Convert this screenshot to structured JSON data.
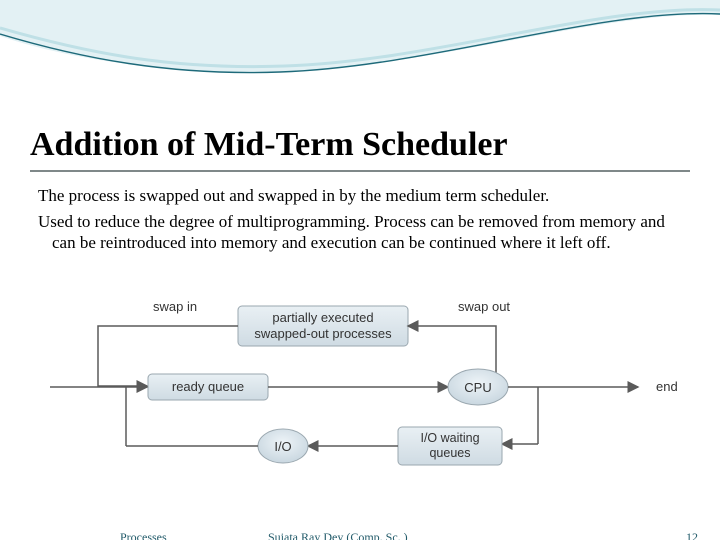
{
  "title": "Addition of Mid-Term Scheduler",
  "paragraphs": [
    "The process is swapped out and swapped in by the medium term scheduler.",
    "Used to reduce the degree of multiprogramming. Process can be removed from memory and can be reintroduced into memory and execution can be continued where it left off."
  ],
  "diagram": {
    "labels": {
      "swap_in": "swap in",
      "swap_out": "swap out"
    },
    "swapped_box": {
      "line1": "partially executed",
      "line2": "swapped-out processes"
    },
    "ready_queue": "ready queue",
    "cpu": "CPU",
    "end": "end",
    "io_wait": {
      "line1": "I/O waiting",
      "line2": "queues"
    },
    "io": "I/O"
  },
  "footer": {
    "left": "Processes",
    "center": "Sujata Ray Dey (Comp. Sc. )",
    "page": "12"
  }
}
